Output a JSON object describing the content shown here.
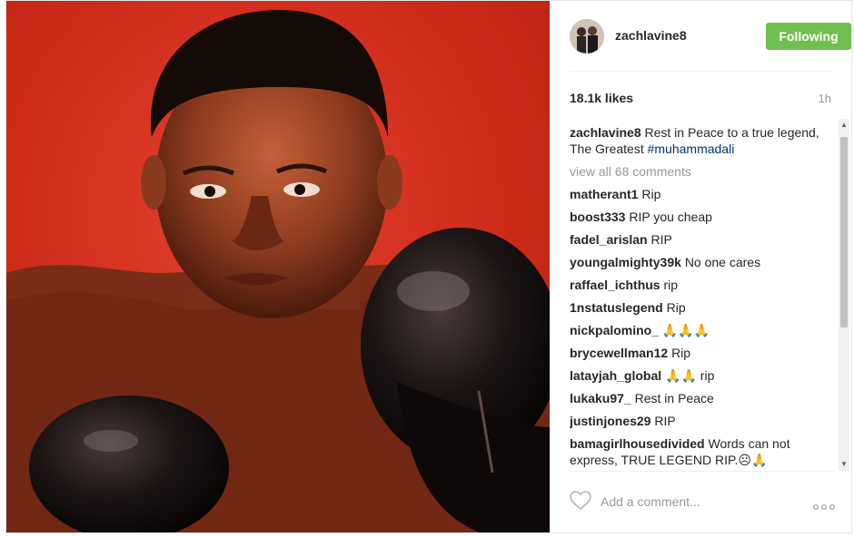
{
  "post": {
    "username": "zachlavine8",
    "follow_label": "Following",
    "likes": "18.1k likes",
    "time": "1h",
    "caption": {
      "username": "zachlavine8",
      "text": "Rest in Peace to a true legend, The Greatest ",
      "hashtag": "#muhammadali"
    },
    "view_all": "view all 68 comments",
    "comments": [
      {
        "user": "matherant1",
        "text": "Rip"
      },
      {
        "user": "boost333",
        "text": "RIP you cheap"
      },
      {
        "user": "fadel_arislan",
        "text": "RIP"
      },
      {
        "user": "youngalmighty39k",
        "text": "No one cares"
      },
      {
        "user": "raffael_ichthus",
        "text": "rip"
      },
      {
        "user": "1nstatuslegend",
        "text": "Rip"
      },
      {
        "user": "nickpalomino_",
        "text": "🙏🙏🙏"
      },
      {
        "user": "brycewellman12",
        "text": "Rip"
      },
      {
        "user": "latayjah_global",
        "text": "🙏🙏 rip"
      },
      {
        "user": "lukaku97_",
        "text": "Rest in Peace"
      },
      {
        "user": "justinjones29",
        "text": "RIP"
      },
      {
        "user": "bamagirlhousedivided",
        "text": "Words can not express, TRUE LEGEND RIP.☹🙏"
      }
    ],
    "add_comment_placeholder": "Add a comment..."
  },
  "icons": {
    "heart": "heart-icon",
    "more": "more-options-icon",
    "scroll_up": "▲",
    "scroll_down": "▼"
  },
  "colors": {
    "follow_button": "#70c050",
    "hashtag": "#003569",
    "photo_background": "#d32f1e"
  }
}
